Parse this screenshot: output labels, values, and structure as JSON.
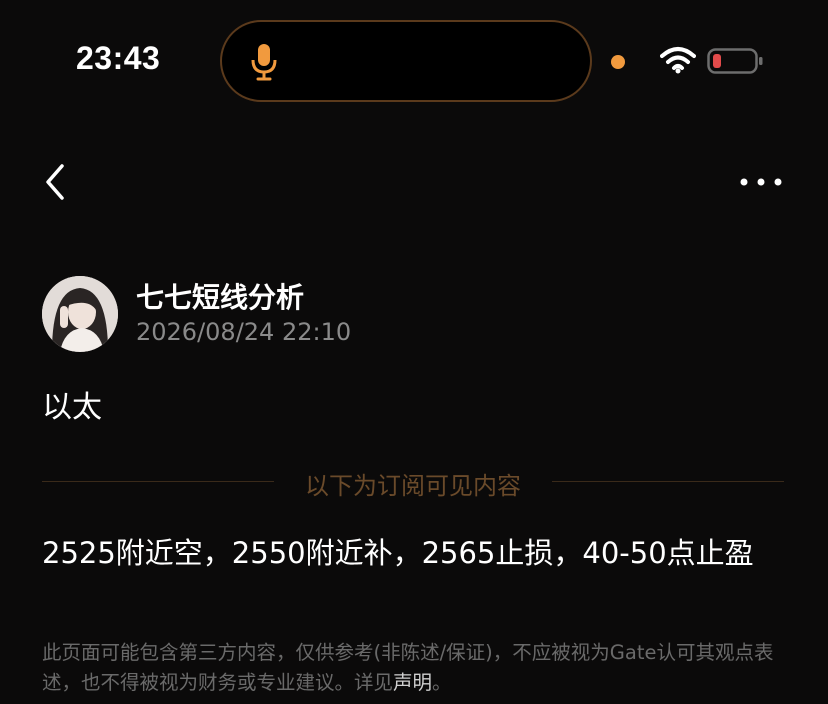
{
  "status_bar": {
    "time": "23:43",
    "accent_color": "#f19a3e",
    "battery_color": "#e24b4b",
    "icons": [
      "microphone-icon",
      "wifi-icon",
      "battery-icon"
    ]
  },
  "nav": {
    "icons": [
      "chevron-left-icon",
      "more-horizontal-icon"
    ]
  },
  "author": {
    "name": "七七短线分析",
    "timestamp": "2026/08/24 22:10"
  },
  "post": {
    "title": "以太",
    "divider_label": "以下为订阅可见内容",
    "content": "2525附近空，2550附近补，2565止损，40-50点止盈"
  },
  "disclaimer": {
    "text": "此页面可能包含第三方内容，仅供参考(非陈述/保证)，不应被视为Gate认可其观点表述，也不得被视为财务或专业建议。详见",
    "link_label": "声明",
    "suffix": "。"
  }
}
